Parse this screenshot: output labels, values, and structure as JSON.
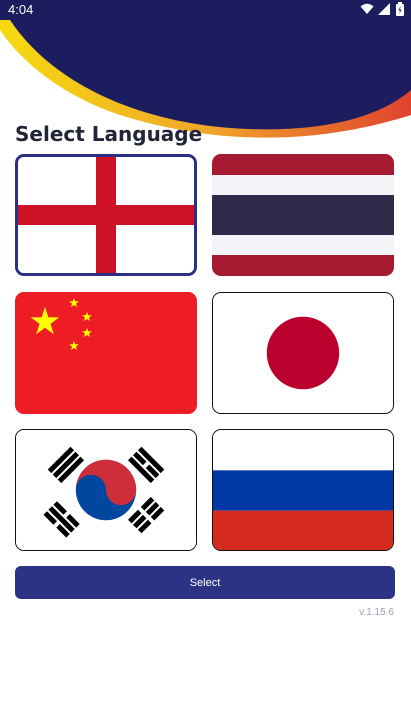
{
  "status_bar": {
    "time": "4:04"
  },
  "page": {
    "title": "Select Language"
  },
  "languages": [
    {
      "flag": "england-flag",
      "selected": true
    },
    {
      "flag": "thailand-flag",
      "selected": false
    },
    {
      "flag": "china-flag",
      "selected": false
    },
    {
      "flag": "japan-flag",
      "selected": false
    },
    {
      "flag": "south-korea-flag",
      "selected": false
    },
    {
      "flag": "russia-flag",
      "selected": false
    }
  ],
  "actions": {
    "select_label": "Select"
  },
  "footer": {
    "version": "v.1.15.6"
  },
  "colors": {
    "primary": "#2d3384",
    "header_navy": "#1c1d5f",
    "accent_yellow": "#f2d300",
    "accent_red": "#e04230"
  }
}
